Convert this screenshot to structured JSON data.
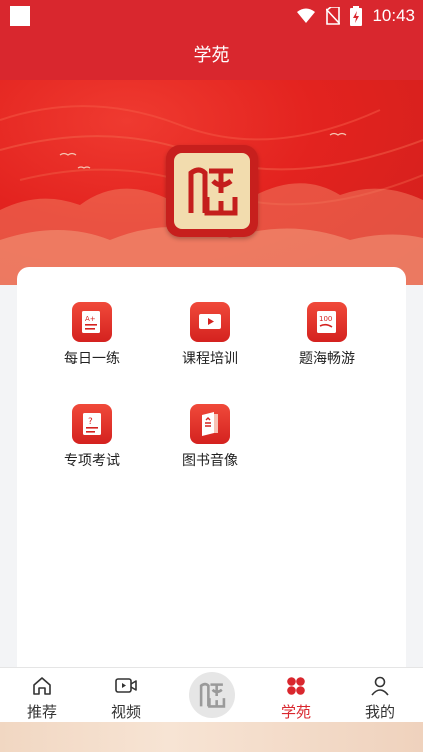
{
  "status_bar": {
    "time": "10:43"
  },
  "header": {
    "title": "学苑"
  },
  "menu": [
    {
      "label": "每日一练",
      "icon": "paper-a-plus-icon"
    },
    {
      "label": "课程培训",
      "icon": "video-play-icon"
    },
    {
      "label": "题海畅游",
      "icon": "score-100-icon"
    },
    {
      "label": "专项考试",
      "icon": "exam-question-icon"
    },
    {
      "label": "图书音像",
      "icon": "book-icon"
    }
  ],
  "bottom_nav": {
    "items": [
      {
        "label": "推荐",
        "icon": "home-icon"
      },
      {
        "label": "视频",
        "icon": "video-icon"
      },
      {
        "label": "学苑",
        "icon": "clover-icon",
        "active": true
      },
      {
        "label": "我的",
        "icon": "user-icon"
      }
    ]
  },
  "colors": {
    "brand": "#d9272e",
    "card": "#ffffff",
    "seal": "#f2dcae"
  }
}
